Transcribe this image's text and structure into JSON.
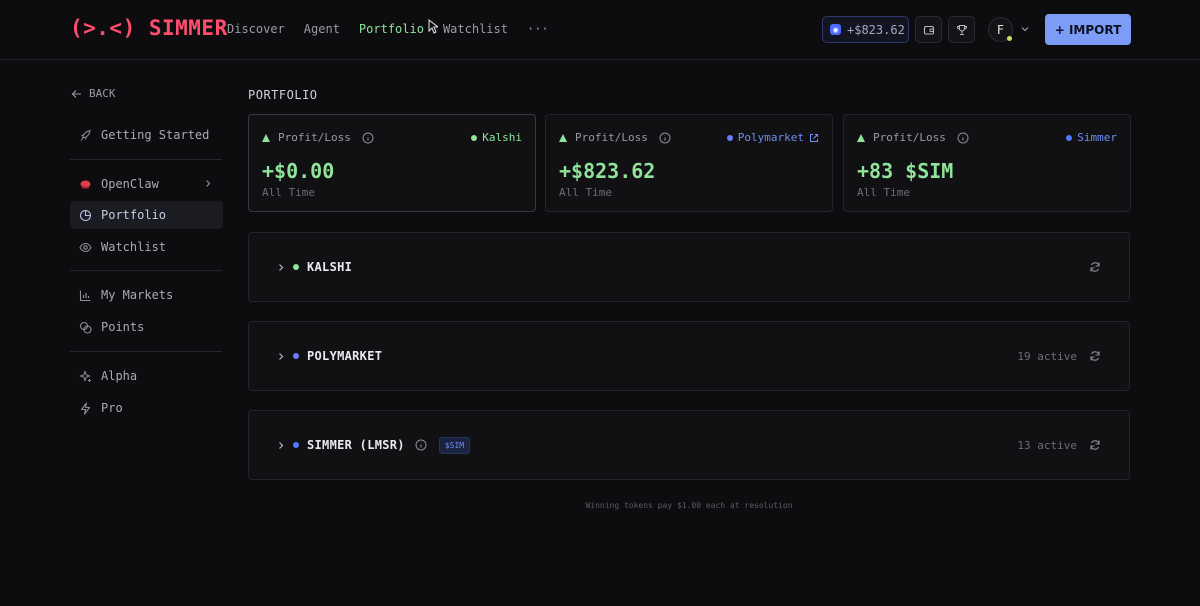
{
  "brand": {
    "logo_text": "(>.<) SIMMER",
    "color": "#ff4d6d"
  },
  "nav": {
    "items": [
      {
        "label": "Discover",
        "active": false
      },
      {
        "label": "Agent",
        "active": false
      },
      {
        "label": "Portfolio",
        "active": true
      },
      {
        "label": "Watchlist",
        "active": false
      }
    ],
    "more": "···"
  },
  "header": {
    "balance": "+$823.62",
    "avatar_initial": "F",
    "import_label": "+ IMPORT"
  },
  "sidebar": {
    "back_label": "BACK",
    "items": [
      {
        "label": "Getting Started",
        "icon": "rocket-icon"
      },
      {
        "label": "OpenClaw",
        "icon": "openclaw-icon"
      },
      {
        "label": "Portfolio",
        "icon": "pie-chart-icon",
        "active": true
      },
      {
        "label": "Watchlist",
        "icon": "eye-icon"
      },
      {
        "label": "My Markets",
        "icon": "bar-chart-icon"
      },
      {
        "label": "Points",
        "icon": "coins-icon"
      },
      {
        "label": "Alpha",
        "icon": "sparkles-icon"
      },
      {
        "label": "Pro",
        "icon": "lightning-icon"
      }
    ]
  },
  "main": {
    "title": "PORTFOLIO",
    "cards": [
      {
        "label": "Profit/Loss",
        "venue": "Kalshi",
        "venue_color": "#8fe39a",
        "value": "+$0.00",
        "sub": "All Time"
      },
      {
        "label": "Profit/Loss",
        "venue": "Polymarket",
        "venue_color": "#6f8ef0",
        "value": "+$823.62",
        "sub": "All Time"
      },
      {
        "label": "Profit/Loss",
        "venue": "Simmer",
        "venue_color": "#4d7bff",
        "value": "+83 $SIM",
        "sub": "All Time"
      }
    ],
    "accounts": [
      {
        "name": "KALSHI",
        "dot_color": "#8fe39a",
        "active": ""
      },
      {
        "name": "POLYMARKET",
        "dot_color": "#6f7bff",
        "active": "19 active"
      },
      {
        "name": "SIMMER (LMSR)",
        "dot_color": "#4d7bff",
        "badge": "$SIM",
        "active": "13 active"
      }
    ],
    "footnote": "Winning tokens pay $1.00 each at resolution"
  },
  "colors": {
    "accent_green": "#8fe39a",
    "accent_blue": "#7b9cf7",
    "background": "#0d0d0f"
  }
}
